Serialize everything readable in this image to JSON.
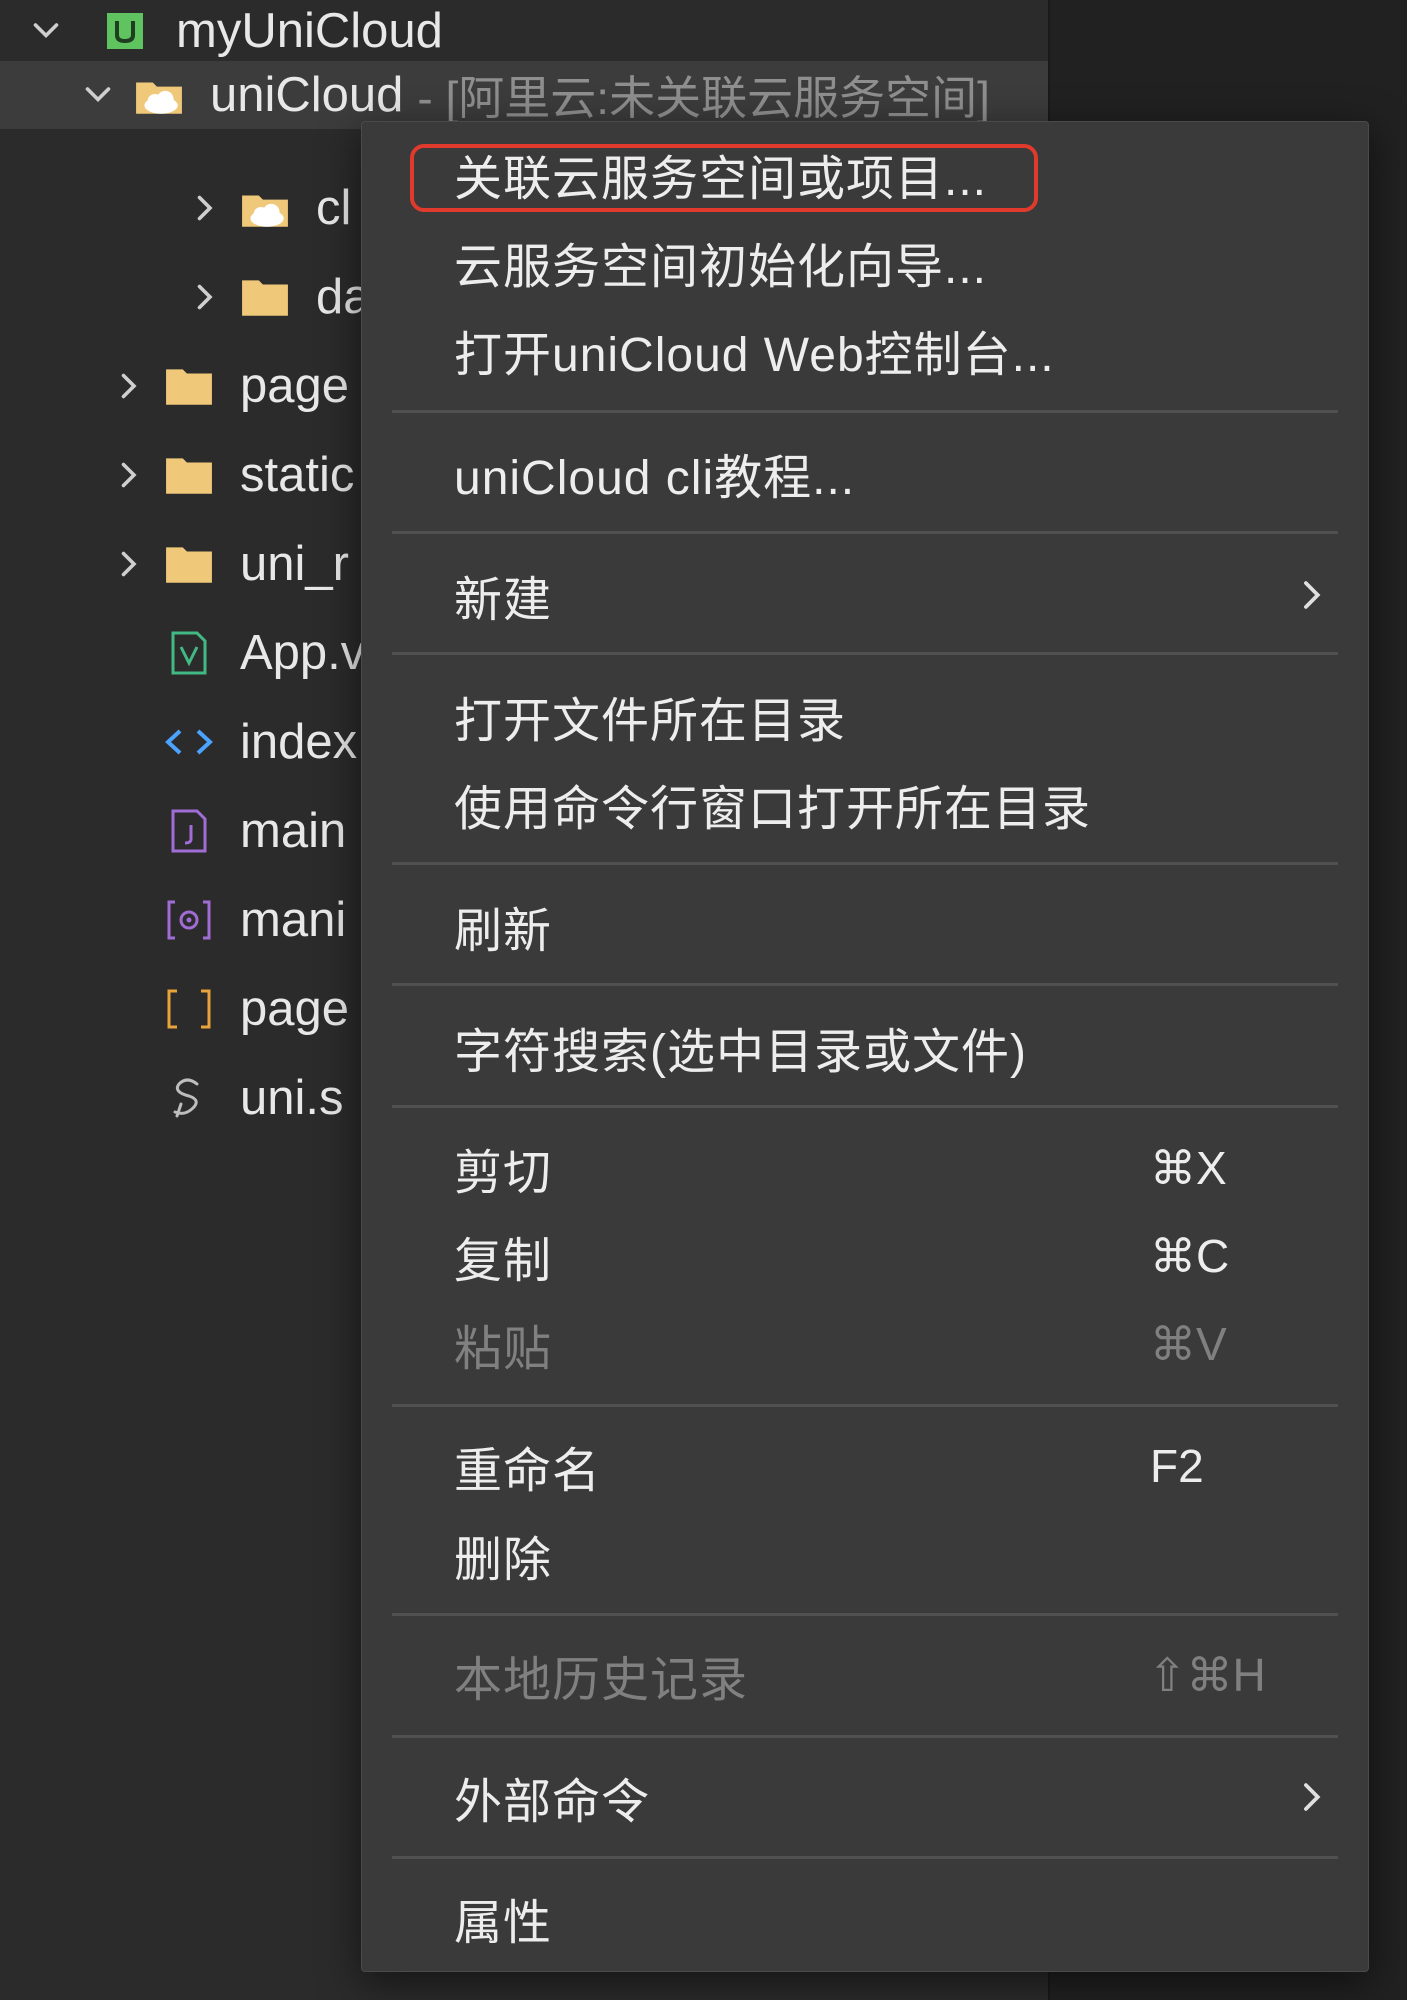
{
  "tree": {
    "project": {
      "label": "myUniCloud"
    },
    "unicloud": {
      "label": "uniCloud",
      "suffix": "- [阿里云:未关联云服务空间]"
    },
    "children": [
      {
        "label": "cl",
        "icon": "cloud-folder-icon"
      },
      {
        "label": "da",
        "icon": "folder-icon"
      }
    ],
    "items": [
      {
        "label": "page",
        "icon": "folder-icon"
      },
      {
        "label": "static",
        "icon": "folder-icon"
      },
      {
        "label": "uni_r",
        "icon": "folder-icon"
      },
      {
        "label": "App.v",
        "icon": "vue-file-icon"
      },
      {
        "label": "index",
        "icon": "html-file-icon"
      },
      {
        "label": "main",
        "icon": "js-file-icon"
      },
      {
        "label": "mani",
        "icon": "manifest-file-icon"
      },
      {
        "label": "page",
        "icon": "json-file-icon"
      },
      {
        "label": "uni.s",
        "icon": "scss-file-icon"
      }
    ]
  },
  "menu": {
    "items": [
      {
        "label": "关联云服务空间或项目..."
      },
      {
        "label": "云服务空间初始化向导..."
      },
      {
        "label": "打开uniCloud Web控制台..."
      },
      {
        "label": "uniCloud cli教程..."
      },
      {
        "label": "新建"
      },
      {
        "label": "打开文件所在目录"
      },
      {
        "label": "使用命令行窗口打开所在目录"
      },
      {
        "label": "刷新"
      },
      {
        "label": "字符搜索(选中目录或文件)"
      },
      {
        "label": "剪切",
        "shortcut": "⌘X"
      },
      {
        "label": "复制",
        "shortcut": "⌘C"
      },
      {
        "label": "粘贴",
        "shortcut": "⌘V",
        "disabled": true
      },
      {
        "label": "重命名",
        "shortcut": "F2"
      },
      {
        "label": "删除"
      },
      {
        "label": "本地历史记录",
        "shortcut": "⇧⌘H",
        "disabled": true
      },
      {
        "label": "外部命令"
      },
      {
        "label": "属性"
      }
    ]
  },
  "colors": {
    "highlight": "#e03a2c",
    "folder": "#f0c87a",
    "project_icon": "#5fc35f",
    "vue": "#42b883",
    "html": "#4aa3ff",
    "file_purple": "#a06cd5",
    "bracket": "#e8a33a"
  }
}
